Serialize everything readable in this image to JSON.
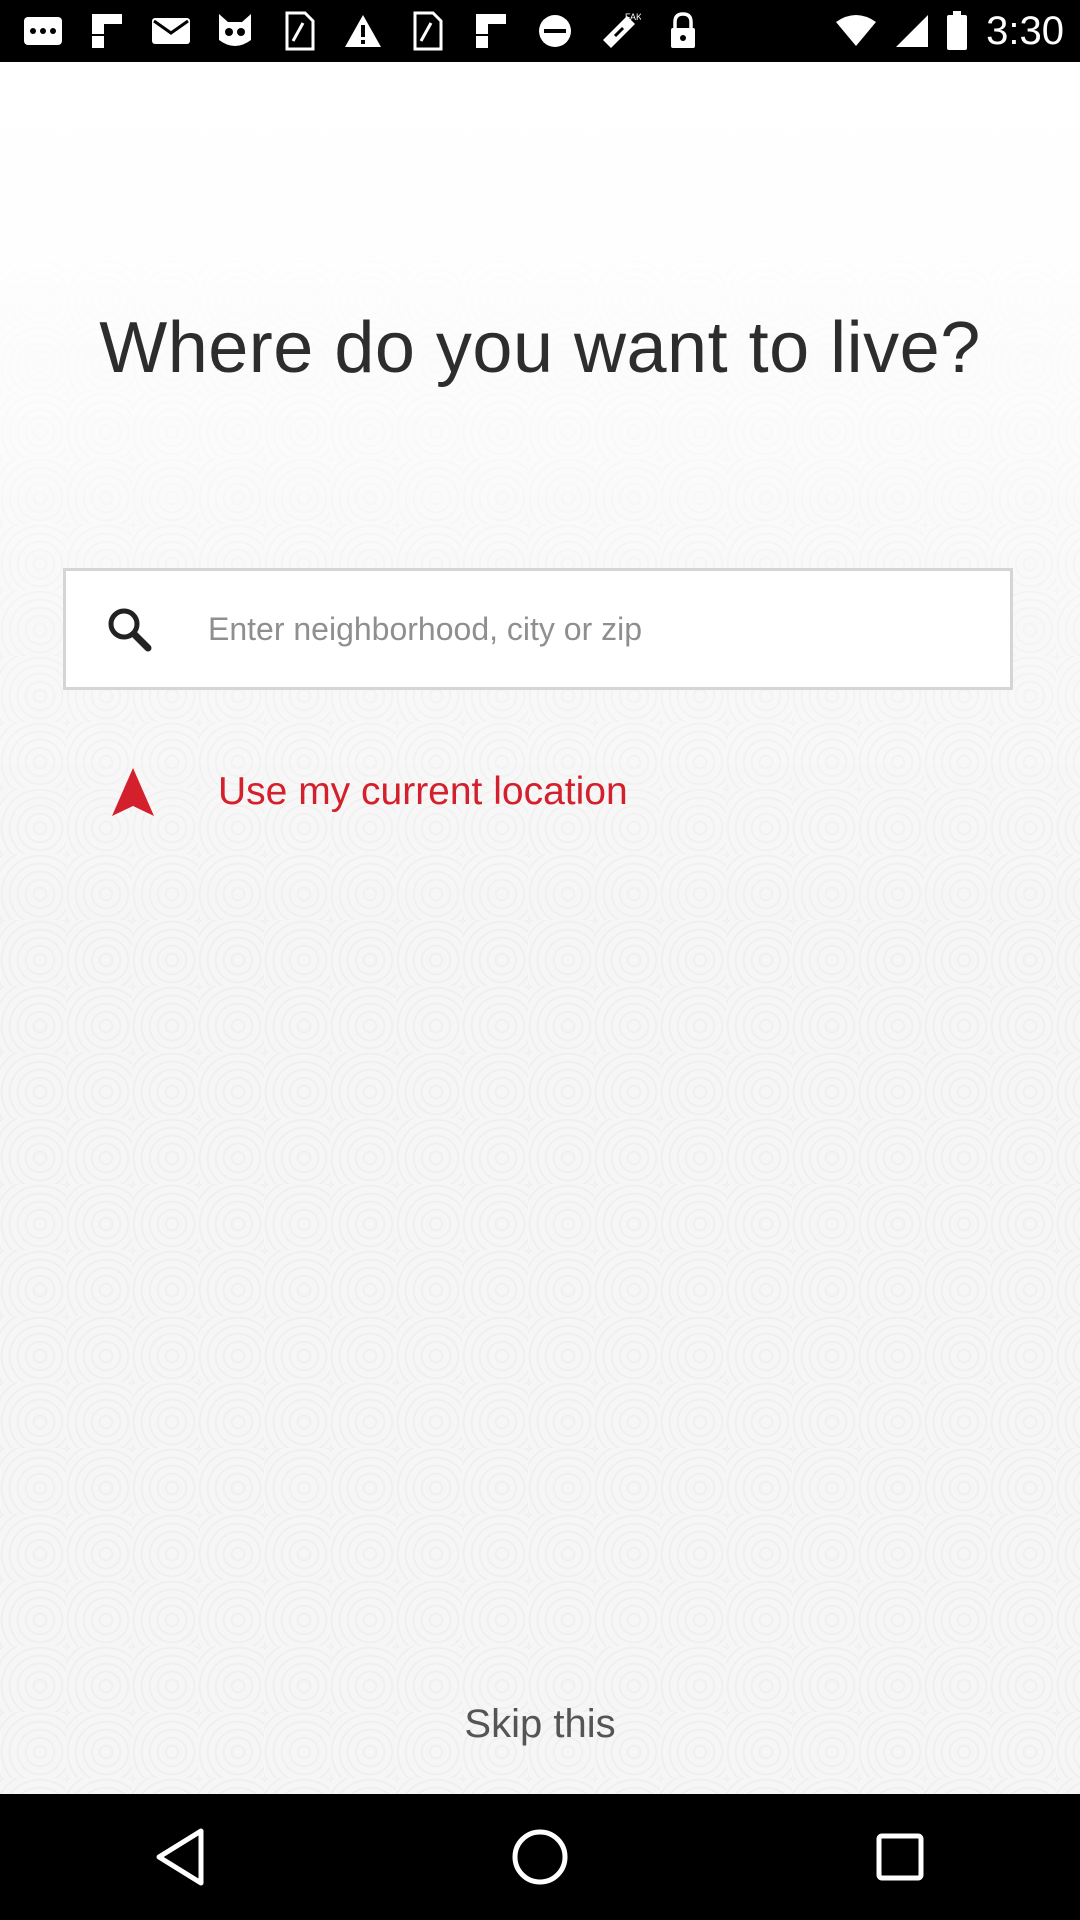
{
  "status_bar": {
    "time": "3:30",
    "left_icons": [
      "more-apps-icon",
      "flipboard-icon",
      "mail-icon",
      "cat-app-icon",
      "sim-tool-icon",
      "warning-icon",
      "sim-tool-icon-2",
      "flipboard-icon-2",
      "cancel-circle-icon",
      "fake-gps-icon",
      "lock-icon"
    ]
  },
  "main": {
    "title": "Where do you want to live?",
    "search": {
      "placeholder": "Enter neighborhood, city or zip",
      "value": ""
    },
    "current_location_label": "Use my current location",
    "skip_label": "Skip this"
  },
  "colors": {
    "accent": "#d4202c",
    "title": "#2d2d2d",
    "placeholder": "#8f8f8f"
  },
  "nav_bar": {
    "buttons": [
      "back-icon",
      "home-icon",
      "recents-icon"
    ]
  }
}
